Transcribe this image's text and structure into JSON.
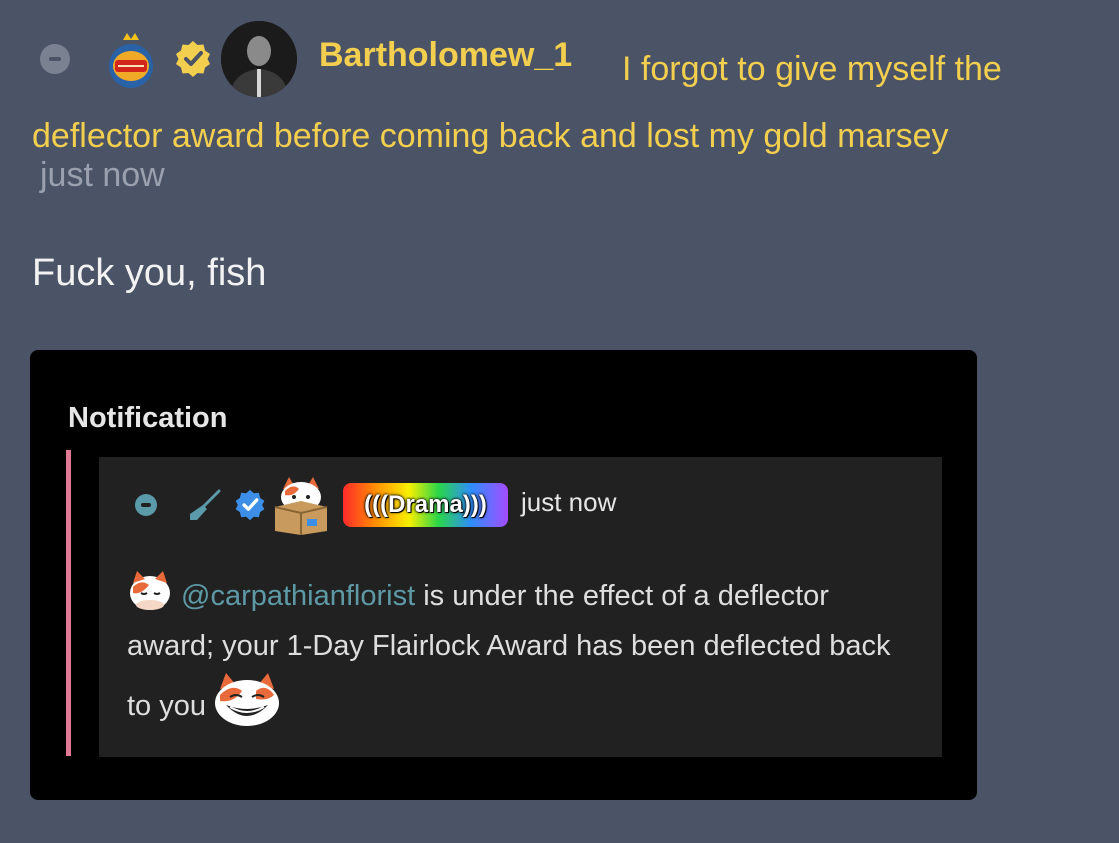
{
  "comment": {
    "username": "Bartholomew_1",
    "flair": "I forgot to give myself the deflector award before coming back and lost my gold marsey",
    "timestamp": "just now",
    "body": "Fuck you, fish",
    "icons": {
      "collapse": "collapse-icon",
      "hat": "burger-king-crown-hat-icon",
      "verified": "verified-badge-icon",
      "avatar": "user-avatar"
    },
    "colors": {
      "background": "#4b5366",
      "username": "#f3cf4f",
      "flair": "#f3cf4f",
      "timestamp": "#9aa0ad"
    }
  },
  "notification": {
    "heading": "Notification",
    "inner_comment": {
      "author_badge": "(((Drama)))",
      "timestamp": "just now",
      "mention": "@carpathianflorist",
      "text_part1": " is under the effect of a deflector award; your 1-Day Flairlock Award has been deflected back to you",
      "icons": {
        "collapse": "collapse-icon",
        "broom": "broom-icon",
        "verified": "verified-badge-icon",
        "avatar": "cat-in-box-icon",
        "inline_emoji": "sleeping-cat-icon",
        "end_emoji": "trollface-cat-icon"
      }
    },
    "colors": {
      "card": "#000000",
      "inner": "#212121",
      "quote_bar": "#e07a96",
      "mention": "#5d9aa6"
    }
  }
}
